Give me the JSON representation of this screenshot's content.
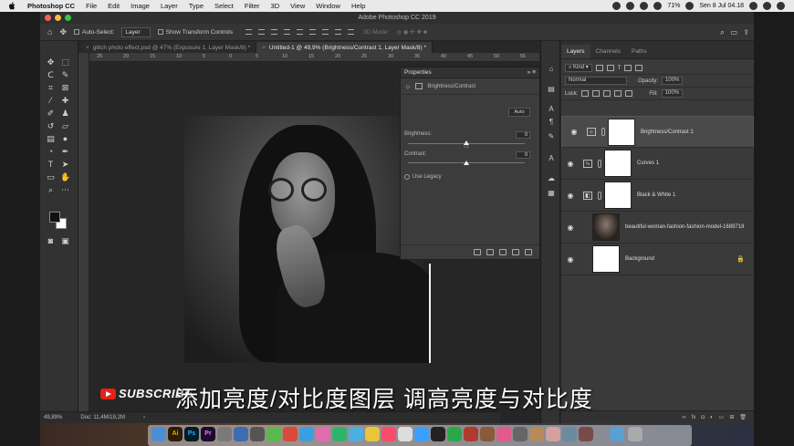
{
  "menubar": {
    "app_name": "Photoshop CC",
    "items": [
      "File",
      "Edit",
      "Image",
      "Layer",
      "Type",
      "Select",
      "Filter",
      "3D",
      "View",
      "Window",
      "Help"
    ],
    "battery": "71%",
    "clock": "Sen 8 Jul 04.18"
  },
  "window": {
    "title": "Adobe Photoshop CC 2019"
  },
  "options": {
    "auto_select_label": "Auto-Select:",
    "auto_select_value": "Layer",
    "transform_label": "Show Transform Controls",
    "mode_3d": "3D Mode:"
  },
  "tabs": [
    {
      "label": "glitch photo effect.psd @ 47% (Exposure 1, Layer Mask/8) *",
      "active": false
    },
    {
      "label": "Untitled-1 @ 49,9% (Brightness/Contrast 1, Layer Mask/8) *",
      "active": true
    }
  ],
  "ruler": {
    "ticks": [
      "25",
      "20",
      "15",
      "10",
      "5",
      "0",
      "5",
      "10",
      "15",
      "20",
      "25",
      "30",
      "35",
      "40",
      "45",
      "50",
      "55"
    ]
  },
  "properties": {
    "title": "Properties",
    "subtitle": "Brightness/Contrast",
    "auto_label": "Auto",
    "brightness_label": "Brightness:",
    "brightness_value": "0",
    "contrast_label": "Contrast:",
    "contrast_value": "0",
    "legacy_label": "Use Legacy"
  },
  "layers_panel": {
    "tabs": [
      "Layers",
      "Channels",
      "Paths"
    ],
    "kind_label": "Kind",
    "blend_mode": "Normal",
    "opacity_label": "Opacity:",
    "opacity_value": "100%",
    "lock_label": "Lock:",
    "fill_label": "Fill:",
    "fill_value": "100%",
    "layers": [
      {
        "name": "Brightness/Contrast 1",
        "selected": true
      },
      {
        "name": "Curves 1",
        "selected": false
      },
      {
        "name": "Black & White 1",
        "selected": false
      },
      {
        "name": "beautiful-woman-fashion-fashion-model-1689718",
        "selected": false
      },
      {
        "name": "Background",
        "selected": false
      }
    ]
  },
  "status": {
    "zoom": "49,89%",
    "doc": "Doc: 11,4M/19,2M"
  },
  "overlay": {
    "subscribe": "SUBSCRIBE",
    "caption": "添加亮度/对比度图层 调高亮度与对比度"
  },
  "dock": {
    "apps": [
      "Ai",
      "Ps",
      "Pr"
    ]
  },
  "colors": {
    "accent": "#e62117",
    "panel": "#3a3a3a"
  }
}
